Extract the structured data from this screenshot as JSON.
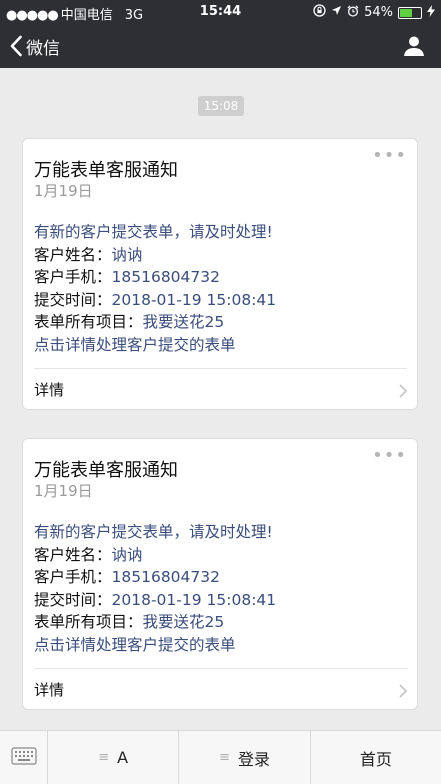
{
  "status_bar": {
    "signal_dots": "●●●●●",
    "carrier": "中国电信",
    "network": "3G",
    "time": "15:44",
    "battery_percent": "54%",
    "battery_level": 0.54,
    "battery_color": "#5fd142"
  },
  "nav": {
    "back_label": "微信",
    "back_icon": "chevron-left-icon",
    "profile_icon": "person-icon"
  },
  "timestamp": "15:08",
  "messages": [
    {
      "title": "万能表单客服通知",
      "date": "1月19日",
      "intro": "有新的客户提交表单，请及时处理!",
      "fields": [
        {
          "label": "客户姓名：",
          "value": "讷讷"
        },
        {
          "label": "客户手机：",
          "value": "18516804732"
        },
        {
          "label": "提交时间：",
          "value": "2018-01-19 15:08:41"
        },
        {
          "label": "表单所有项目：",
          "value": "我要送花25"
        }
      ],
      "footer_note": "点击详情处理客户提交的表单",
      "detail_label": "详情",
      "more_icon": "•••"
    },
    {
      "title": "万能表单客服通知",
      "date": "1月19日",
      "intro": "有新的客户提交表单，请及时处理!",
      "fields": [
        {
          "label": "客户姓名：",
          "value": "讷讷"
        },
        {
          "label": "客户手机：",
          "value": "18516804732"
        },
        {
          "label": "提交时间：",
          "value": "2018-01-19 15:08:41"
        },
        {
          "label": "表单所有项目：",
          "value": "我要送花25"
        }
      ],
      "footer_note": "点击详情处理客户提交的表单",
      "detail_label": "详情",
      "more_icon": "•••"
    }
  ],
  "bottom_menu": {
    "keyboard_icon": "keyboard-icon",
    "menu_icon_glyph": "≡",
    "items": [
      {
        "label": "A"
      },
      {
        "label": "登录"
      },
      {
        "label": "首页"
      }
    ]
  },
  "colors": {
    "header_bg": "#2e2f33",
    "link_blue": "#3a4d7d",
    "page_bg": "#ebebeb"
  }
}
